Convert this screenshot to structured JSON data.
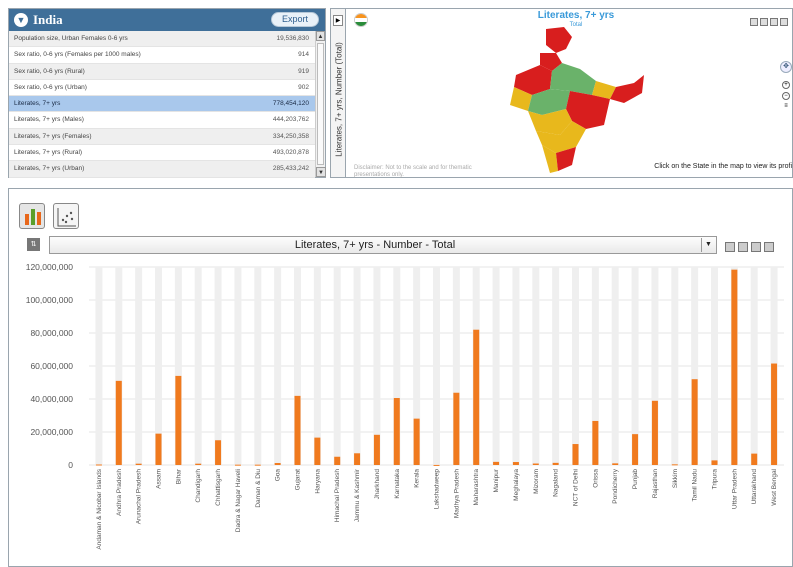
{
  "left_panel": {
    "title": "India",
    "export_label": "Export",
    "rows": [
      {
        "label": "Population size, Urban Females 0-6 yrs",
        "value": "19,536,830",
        "selected": false
      },
      {
        "label": "Sex ratio, 0-6 yrs (Females per 1000 males)",
        "value": "914",
        "selected": false
      },
      {
        "label": "Sex ratio, 0-6 yrs (Rural)",
        "value": "919",
        "selected": false
      },
      {
        "label": "Sex ratio, 0-6 yrs (Urban)",
        "value": "902",
        "selected": false
      },
      {
        "label": "Literates, 7+ yrs",
        "value": "778,454,120",
        "selected": true
      },
      {
        "label": "Literates, 7+ yrs (Males)",
        "value": "444,203,762",
        "selected": false
      },
      {
        "label": "Literates, 7+ yrs (Females)",
        "value": "334,250,358",
        "selected": false
      },
      {
        "label": "Literates, 7+ yrs (Rural)",
        "value": "493,020,878",
        "selected": false
      },
      {
        "label": "Literates, 7+ yrs (Urban)",
        "value": "285,433,242",
        "selected": false
      }
    ]
  },
  "vertical_label": "Literates, 7+ yrs, Number (Total)",
  "map": {
    "title": "Literates, 7+ yrs",
    "subtitle": "Total",
    "disclaimer": "Disclaimer: Not to the scale and for thematic presentations only.",
    "click_hint": "Click on the State in the map to view its profi"
  },
  "chart_selector": {
    "selected": "Literates, 7+ yrs - Number - Total"
  },
  "colors": {
    "bar": "#f07a1e",
    "track": "#efefef",
    "header": "#3f6f99",
    "selected_row": "#a9c8ec"
  },
  "chart_data": {
    "type": "bar",
    "title": "Literates, 7+ yrs - Number - Total",
    "ylim": [
      0,
      120000000
    ],
    "yticks": [
      "0",
      "20,000,000",
      "40,000,000",
      "60,000,000",
      "80,000,000",
      "100,000,000",
      "120,000,000"
    ],
    "grid": true,
    "categories": [
      "Andaman & Nicobar Islands",
      "Andhra Pradesh",
      "Arunachal Pradesh",
      "Assam",
      "Bihar",
      "Chandigarh",
      "Chhattisgarh",
      "Dadra & Nagar Haveli",
      "Daman & Diu",
      "Goa",
      "Gujarat",
      "Haryana",
      "Himachal Pradesh",
      "Jammu & Kashmir",
      "Jharkhand",
      "Karnataka",
      "Kerala",
      "Lakshadweep",
      "Madhya Pradesh",
      "Maharashtra",
      "Manipur",
      "Meghalaya",
      "Mizoram",
      "Nagaland",
      "NCT of Delhi",
      "Orissa",
      "Pondicherry",
      "Punjab",
      "Rajasthan",
      "Sikkim",
      "Tamil Nadu",
      "Tripura",
      "Uttar Pradesh",
      "Uttarakhand",
      "West Bengal"
    ],
    "values": [
      300000,
      51000000,
      800000,
      19000000,
      54000000,
      800000,
      15000000,
      200000,
      200000,
      1200000,
      41900000,
      16600000,
      5000000,
      7100000,
      18300000,
      40600000,
      28100000,
      50000,
      43800000,
      82000000,
      1900000,
      1800000,
      900000,
      1300000,
      12700000,
      26700000,
      1000000,
      18700000,
      38900000,
      400000,
      52000000,
      2800000,
      118400000,
      6900000,
      61500000
    ]
  }
}
